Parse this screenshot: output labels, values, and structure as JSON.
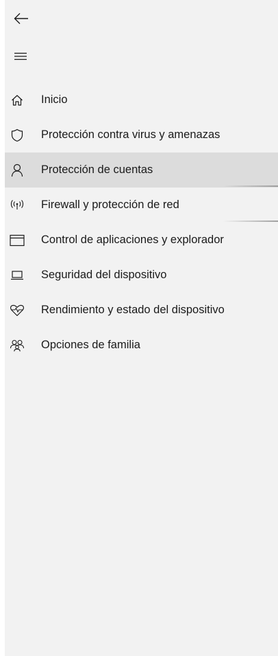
{
  "toolbar": {
    "back_icon": "back-arrow-icon",
    "menu_icon": "hamburger-menu-icon"
  },
  "nav": {
    "selected_index": 2,
    "items": [
      {
        "label": "Inicio",
        "icon": "home-icon"
      },
      {
        "label": "Protección contra virus y amenazas",
        "icon": "shield-icon"
      },
      {
        "label": "Protección de cuentas",
        "icon": "person-icon"
      },
      {
        "label": "Firewall y protección de red",
        "icon": "antenna-icon"
      },
      {
        "label": "Control de aplicaciones y explorador",
        "icon": "browser-window-icon"
      },
      {
        "label": "Seguridad del dispositivo",
        "icon": "laptop-icon"
      },
      {
        "label": "Rendimiento y estado del dispositivo",
        "icon": "heart-pulse-icon"
      },
      {
        "label": "Opciones de familia",
        "icon": "family-icon"
      }
    ]
  },
  "colors": {
    "pane_background": "#f2f2f2",
    "selected_background": "#dcdcdc",
    "text": "#1a1a1a"
  }
}
